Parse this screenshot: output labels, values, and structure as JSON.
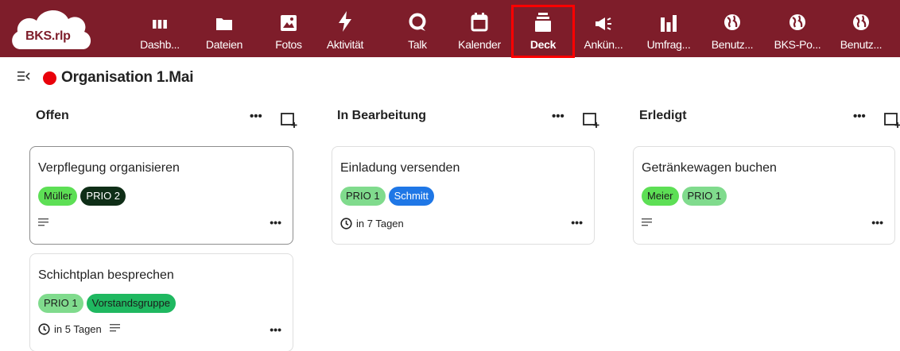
{
  "logo": {
    "text": "BKS.rlp"
  },
  "apps": [
    {
      "id": "dashboard",
      "label": "Dashb...",
      "icon": "dashboard-icon",
      "active": false
    },
    {
      "id": "dateien",
      "label": "Dateien",
      "icon": "folder-icon",
      "active": false
    },
    {
      "id": "fotos",
      "label": "Fotos",
      "icon": "image-icon",
      "active": false
    },
    {
      "id": "aktivitaet",
      "label": "Aktivität",
      "icon": "lightning-icon",
      "active": false
    },
    {
      "id": "talk",
      "label": "Talk",
      "icon": "talk-icon",
      "active": false
    },
    {
      "id": "kalender",
      "label": "Kalender",
      "icon": "calendar-icon",
      "active": false
    },
    {
      "id": "deck",
      "label": "Deck",
      "icon": "deck-icon",
      "active": true
    },
    {
      "id": "ankuendigungen",
      "label": "Ankün...",
      "icon": "megaphone-icon",
      "active": false
    },
    {
      "id": "umfragen",
      "label": "Umfrag...",
      "icon": "poll-icon",
      "active": false
    },
    {
      "id": "benutzer1",
      "label": "Benutz...",
      "icon": "globe-icon",
      "active": false
    },
    {
      "id": "bks-portal",
      "label": "BKS-Po...",
      "icon": "globe-icon",
      "active": false
    },
    {
      "id": "benutzer2",
      "label": "Benutz...",
      "icon": "globe-icon",
      "active": false
    }
  ],
  "board": {
    "title": "Organisation 1.Mai",
    "color": "#e9010b"
  },
  "stacks": [
    {
      "title": "Offen",
      "cards": [
        {
          "title": "Verpflegung organisieren",
          "labels": [
            {
              "text": "Müller",
              "bg": "#5ddf55",
              "fg": "#1b1b1b"
            },
            {
              "text": "PRIO 2",
              "bg": "#0f2e17",
              "fg": "#ffffff"
            }
          ],
          "due": "",
          "has_description": true,
          "selected": true
        },
        {
          "title": "Schichtplan besprechen",
          "labels": [
            {
              "text": "PRIO 1",
              "bg": "#80db8d",
              "fg": "#1b1b1b"
            },
            {
              "text": "Vorstandsgruppe",
              "bg": "#1fb860",
              "fg": "#1b1b1b"
            }
          ],
          "due": "in 5 Tagen",
          "has_description": true,
          "selected": false
        }
      ]
    },
    {
      "title": "In Bearbeitung",
      "cards": [
        {
          "title": "Einladung versenden",
          "labels": [
            {
              "text": "PRIO 1",
              "bg": "#80db8d",
              "fg": "#1b1b1b"
            },
            {
              "text": "Schmitt",
              "bg": "#1f77e6",
              "fg": "#ffffff"
            }
          ],
          "due": "in 7 Tagen",
          "has_description": false,
          "selected": false
        }
      ]
    },
    {
      "title": "Erledigt",
      "cards": [
        {
          "title": "Getränkewagen buchen",
          "labels": [
            {
              "text": "Meier",
              "bg": "#5ddf55",
              "fg": "#1b1b1b"
            },
            {
              "text": "PRIO 1",
              "bg": "#80db8d",
              "fg": "#1b1b1b"
            }
          ],
          "due": "",
          "has_description": true,
          "selected": false
        }
      ]
    }
  ],
  "ui": {
    "stack_menu": "•••",
    "card_menu": "•••"
  },
  "colors": {
    "header_bg": "#7e1d2a",
    "highlight": "#ff0000"
  }
}
